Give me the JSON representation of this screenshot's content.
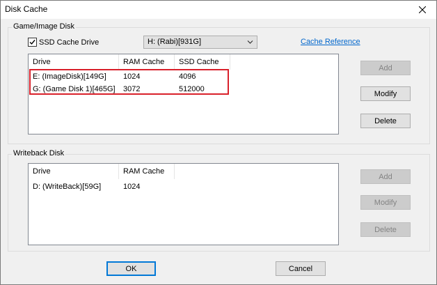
{
  "window": {
    "title": "Disk Cache"
  },
  "game_image_disk": {
    "group_label": "Game/Image Disk",
    "ssd_cache_checkbox": {
      "label": "SSD Cache Drive",
      "checked": true
    },
    "ssd_drive_dropdown": {
      "value": "H: (Rabi)[931G]"
    },
    "cache_reference_link": "Cache Reference",
    "table": {
      "headers": [
        "Drive",
        "RAM Cache",
        "SSD Cache"
      ],
      "rows": [
        [
          "E: (ImageDisk)[149G]",
          "1024",
          "4096"
        ],
        [
          "G: (Game Disk 1)[465G]",
          "3072",
          "512000"
        ]
      ]
    },
    "buttons": {
      "add": "Add",
      "modify": "Modify",
      "delete": "Delete"
    }
  },
  "writeback_disk": {
    "group_label": "Writeback Disk",
    "table": {
      "headers": [
        "Drive",
        "RAM Cache"
      ],
      "rows": [
        [
          "D: (WriteBack)[59G]",
          "1024"
        ]
      ]
    },
    "buttons": {
      "add": "Add",
      "modify": "Modify",
      "delete": "Delete"
    }
  },
  "footer": {
    "ok": "OK",
    "cancel": "Cancel"
  },
  "colors": {
    "highlight": "#d9202a",
    "link": "#0066cc",
    "default_button_border": "#0078d7"
  }
}
